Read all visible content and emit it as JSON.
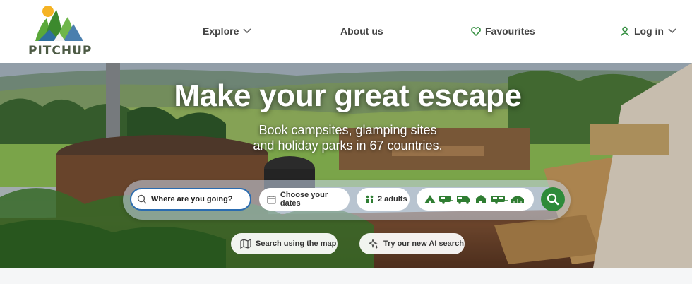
{
  "brand": {
    "name": "PITCHUP"
  },
  "nav": {
    "explore": "Explore",
    "about": "About us",
    "favourites": "Favourites",
    "login": "Log in"
  },
  "hero": {
    "title": "Make your great escape",
    "subtitle_line1": "Book campsites, glamping sites",
    "subtitle_line2": "and holiday parks in 67 countries."
  },
  "search": {
    "where_placeholder": "Where are you going?",
    "dates_label": "Choose your dates",
    "guests_label": "2 adults",
    "accommodation_type_icons": [
      "tent-icon",
      "caravan-icon",
      "motorhome-icon",
      "lodge-icon",
      "touring-caravan-icon",
      "glamping-pod-icon"
    ]
  },
  "actions": {
    "map_search": "Search using the map",
    "ai_search": "Try our new AI search"
  },
  "colors": {
    "brand_green": "#2e8b3a",
    "icon_green": "#2f7d32",
    "input_border": "#2b6cb0"
  }
}
